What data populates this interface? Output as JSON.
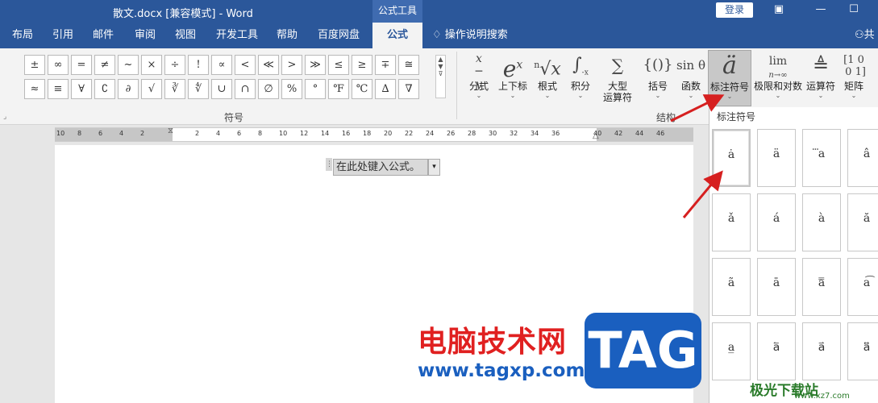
{
  "titlebar": {
    "document_title": "散文.docx [兼容模式]  -  Word",
    "context_group": "公式工具",
    "login_label": "登录",
    "ribbon_options_icon": "ribbon-display-icon",
    "minimize_icon": "minimize-icon",
    "maximize_icon": "maximize-icon"
  },
  "tabs": [
    {
      "label": "布局"
    },
    {
      "label": "引用"
    },
    {
      "label": "邮件"
    },
    {
      "label": "审阅"
    },
    {
      "label": "视图"
    },
    {
      "label": "开发工具"
    },
    {
      "label": "帮助"
    },
    {
      "label": "百度网盘"
    },
    {
      "label": "公式",
      "active": true
    }
  ],
  "tell_me": "操作说明搜索",
  "share_label": "共",
  "symbols": {
    "group_label": "符号",
    "items": [
      "±",
      "∞",
      "=",
      "≠",
      "~",
      "×",
      "÷",
      "!",
      "∝",
      "<",
      "≪",
      ">",
      "≫",
      "≤",
      "≥",
      "∓",
      "≅",
      "≈",
      "≡",
      "∀",
      "∁",
      "∂",
      "√",
      "∛",
      "∜",
      "∪",
      "∩",
      "∅",
      "%",
      "°",
      "℉",
      "℃",
      "∆",
      "∇"
    ]
  },
  "structures": {
    "group_label": "结构",
    "items": [
      {
        "label": "分式",
        "glyph": "x/y"
      },
      {
        "label": "上下标",
        "glyph": "eˣ"
      },
      {
        "label": "根式",
        "glyph": "ⁿ√x"
      },
      {
        "label": "积分",
        "glyph": "∫"
      },
      {
        "label": "大型\n运算符",
        "glyph": "∑"
      },
      {
        "label": "括号",
        "glyph": "{()}"
      },
      {
        "label": "函数",
        "glyph": "sinθ"
      },
      {
        "label": "标注符号",
        "glyph": "ä",
        "selected": true
      },
      {
        "label": "极限和对数",
        "glyph": "lim"
      },
      {
        "label": "运算符",
        "glyph": "≜"
      },
      {
        "label": "矩阵",
        "glyph": "[10]"
      }
    ]
  },
  "ruler": {
    "numbers": [
      "10",
      "8",
      "6",
      "4",
      "2",
      "2",
      "4",
      "6",
      "8",
      "10",
      "12",
      "14",
      "16",
      "18",
      "20",
      "22",
      "24",
      "26",
      "28",
      "30",
      "32",
      "34",
      "36",
      "40",
      "42",
      "44",
      "46"
    ]
  },
  "document": {
    "equation_placeholder": "在此处键入公式。"
  },
  "accent_dropdown": {
    "title": "标注符号",
    "items": [
      "ȧ",
      "ä",
      "⃛a",
      "â",
      "ǎ",
      "á",
      "à",
      "ă",
      "ã",
      "ā",
      "a̿",
      "a͡",
      "a̲",
      "a⃐",
      "a⃑",
      "a⃡"
    ]
  },
  "watermark": {
    "cn_text": "电脑技术网",
    "url": "www.tagxp.com",
    "tag_text": "TAG",
    "site_name": "极光下载站",
    "site_url": "www.xz7.com"
  },
  "colors": {
    "title_blue": "#2b579a",
    "arrow_red": "#d62020"
  }
}
